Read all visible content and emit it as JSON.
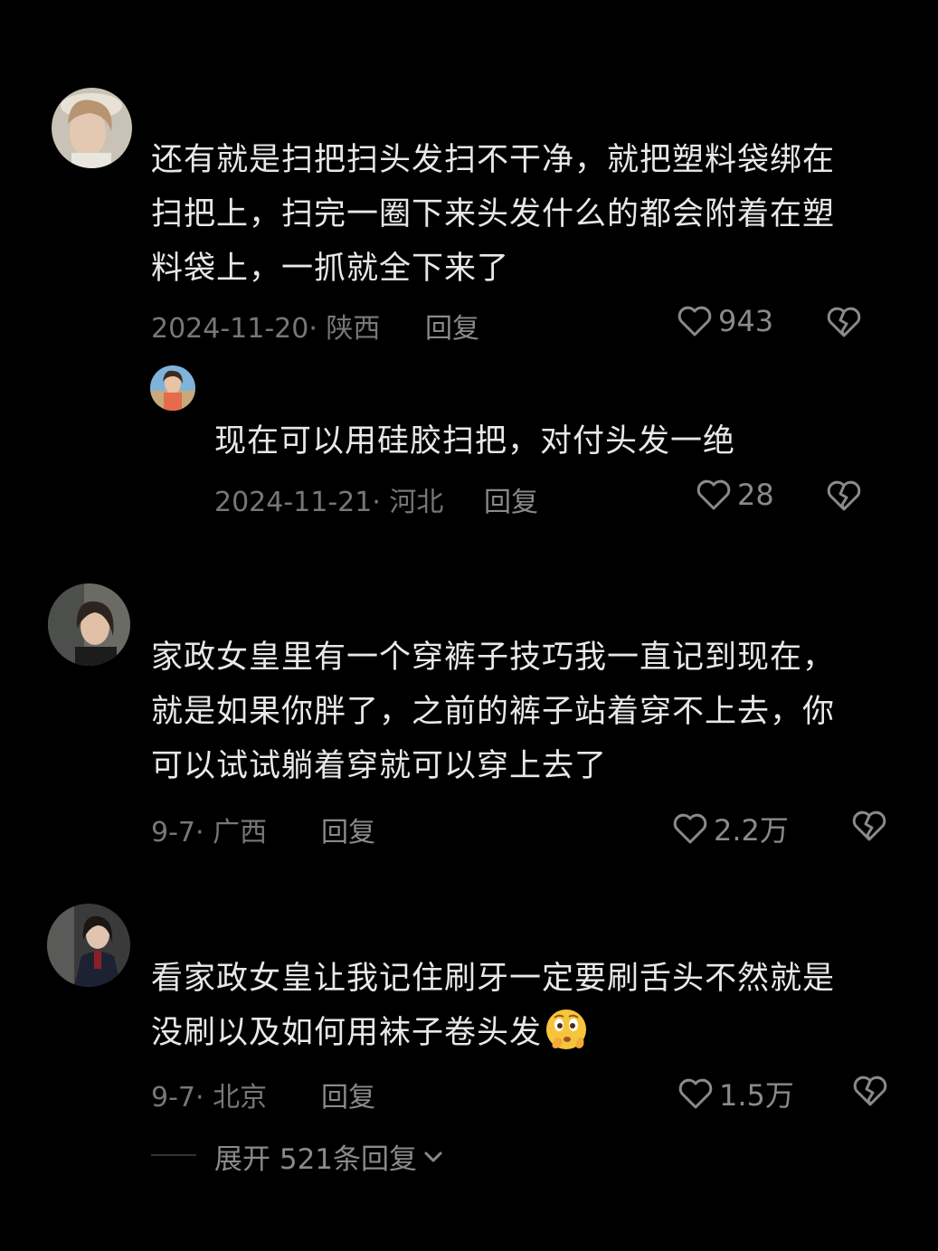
{
  "comments": [
    {
      "text": "还有就是扫把扫头发扫不干净，就把塑料袋绑在\n扫把上，扫完一圈下来头发什么的都会附着在塑\n料袋上，一抓就全下来了",
      "meta": "2024-11-20· 陕西",
      "reply_label": "回复",
      "likes": "943",
      "replies": [
        {
          "text": "现在可以用硅胶扫把，对付头发一绝",
          "meta": "2024-11-21· 河北",
          "reply_label": "回复",
          "likes": "28"
        }
      ]
    },
    {
      "text": "家政女皇里有一个穿裤子技巧我一直记到现在，\n就是如果你胖了，之前的裤子站着穿不上去，你\n可以试试躺着穿就可以穿上去了",
      "meta": "9-7· 广西",
      "reply_label": "回复",
      "likes": "2.2万"
    },
    {
      "text": "看家政女皇让我记住刷牙一定要刷舌头不然就是\n没刷以及如何用袜子卷头发",
      "meta": "9-7· 北京",
      "reply_label": "回复",
      "likes": "1.5万",
      "emoji": "shushing-face-emoji",
      "expand_label": "展开 521条回复"
    }
  ],
  "icons": {
    "like": "heart-outline-icon",
    "dislike": "broken-heart-icon",
    "expand": "chevron-down-icon"
  },
  "colors": {
    "background": "#000000",
    "text": "#e8e8e8",
    "muted": "#777777"
  }
}
